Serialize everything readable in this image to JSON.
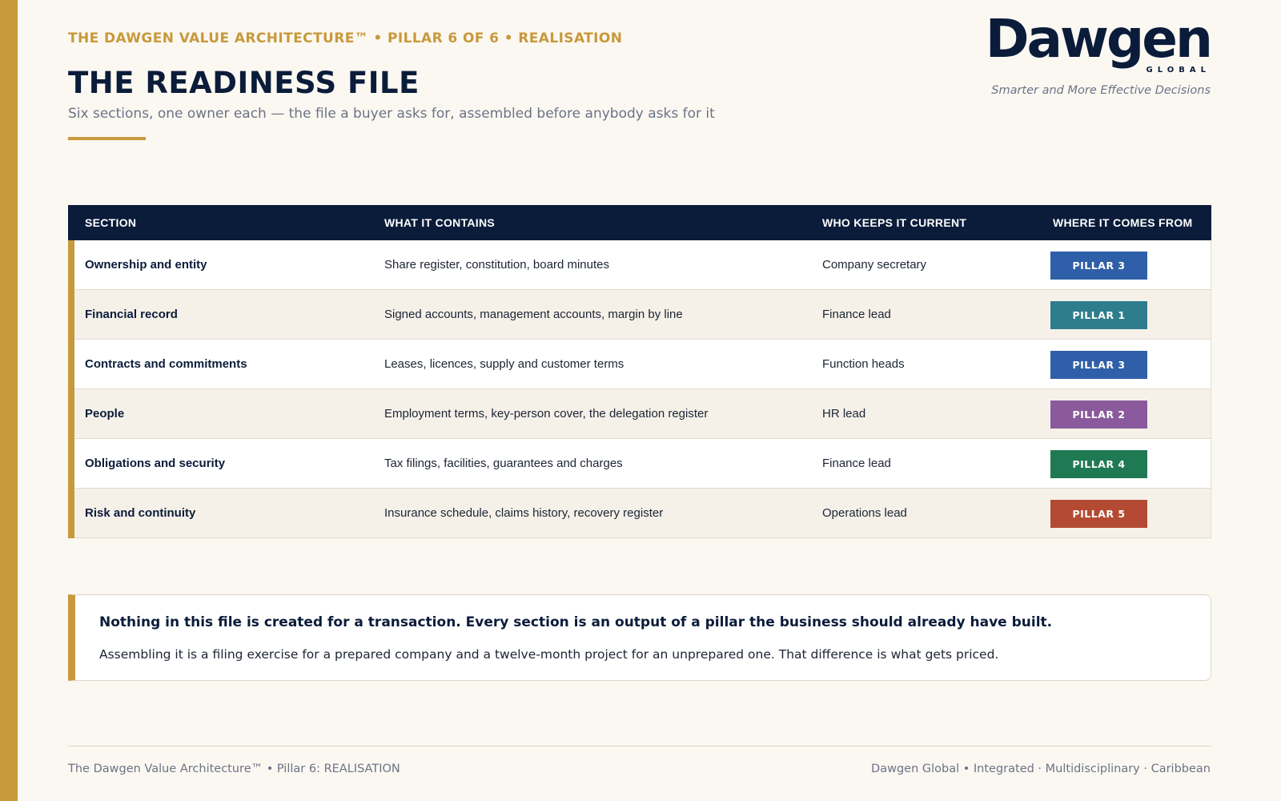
{
  "header": {
    "eyebrow": "THE DAWGEN VALUE ARCHITECTURE™  •  PILLAR 6 OF 6  •  REALISATION",
    "title": "THE READINESS FILE",
    "subtitle": "Six sections, one owner each — the file a buyer asks for, assembled before anybody asks for it"
  },
  "brand": {
    "logo_text": "Dawgen",
    "logo_sub": "GLOBAL",
    "tagline": "Smarter and More Effective Decisions"
  },
  "table": {
    "columns": [
      "SECTION",
      "WHAT IT CONTAINS",
      "WHO KEEPS IT CURRENT",
      "WHERE IT COMES FROM"
    ],
    "rows": [
      {
        "section": "Ownership and entity",
        "contains": "Share register, constitution, board minutes",
        "owner": "Company secretary",
        "source": "PILLAR 3",
        "color": "#2f5fa8"
      },
      {
        "section": "Financial record",
        "contains": "Signed accounts, management accounts, margin by line",
        "owner": "Finance lead",
        "source": "PILLAR 1",
        "color": "#2e7d8c"
      },
      {
        "section": "Contracts and commitments",
        "contains": "Leases, licences, supply and customer terms",
        "owner": "Function heads",
        "source": "PILLAR 3",
        "color": "#2f5fa8"
      },
      {
        "section": "People",
        "contains": "Employment terms, key-person cover, the delegation register",
        "owner": "HR lead",
        "source": "PILLAR 2",
        "color": "#8a5a9c"
      },
      {
        "section": "Obligations and security",
        "contains": "Tax filings, facilities, guarantees and charges",
        "owner": "Finance lead",
        "source": "PILLAR 4",
        "color": "#1f7a53"
      },
      {
        "section": "Risk and continuity",
        "contains": "Insurance schedule, claims history, recovery register",
        "owner": "Operations lead",
        "source": "PILLAR 5",
        "color": "#b44a33"
      }
    ]
  },
  "callout": {
    "headline": "Nothing in this file is created for a transaction. Every section is an output of a pillar the business should already have built.",
    "body": "Assembling it is a filing exercise for a prepared company and a twelve-month project for an unprepared one. That difference is what gets priced."
  },
  "footer": {
    "left": "The Dawgen Value Architecture™  •  Pillar 6: REALISATION",
    "right": "Dawgen Global  •  Integrated · Multidisciplinary · Caribbean"
  },
  "colors": {
    "accent_gold": "#c8993b",
    "navy": "#0b1c3a",
    "background": "#fbf8f2"
  }
}
